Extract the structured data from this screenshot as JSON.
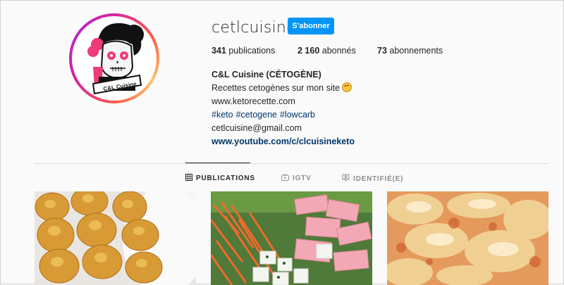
{
  "profile": {
    "username": "cetlcuisine",
    "follow_label": "S'abonner",
    "avatar_text": "C&L Cuisine"
  },
  "stats": {
    "posts_count": "341",
    "posts_label": " publications",
    "followers_count": "2 160",
    "followers_label": " abonnés",
    "following_count": "73",
    "following_label": " abonnements"
  },
  "bio": {
    "name": "C&L Cuisine (CÉTOGÈNE)",
    "tagline": "Recettes cetogènes sur mon site",
    "emoji": "winking-face-emoji",
    "website": "www.ketorecette.com",
    "hashtags": [
      "#keto",
      "#cetogene",
      "#lowcarb"
    ],
    "email": "cetlcuisine@gmail.com",
    "youtube": "www.youtube.com/c/clcuisineketo"
  },
  "tabs": [
    {
      "label": "PUBLICATIONS",
      "icon": "grid-icon",
      "active": true
    },
    {
      "label": "IGTV",
      "icon": "igtv-icon",
      "active": false
    },
    {
      "label": "IDENTIFIÉ(E)",
      "icon": "tagged-icon",
      "active": false
    }
  ],
  "colors": {
    "follow_button": "#0095f6",
    "link": "#00376b",
    "avatar_ring": "#d6249f"
  }
}
